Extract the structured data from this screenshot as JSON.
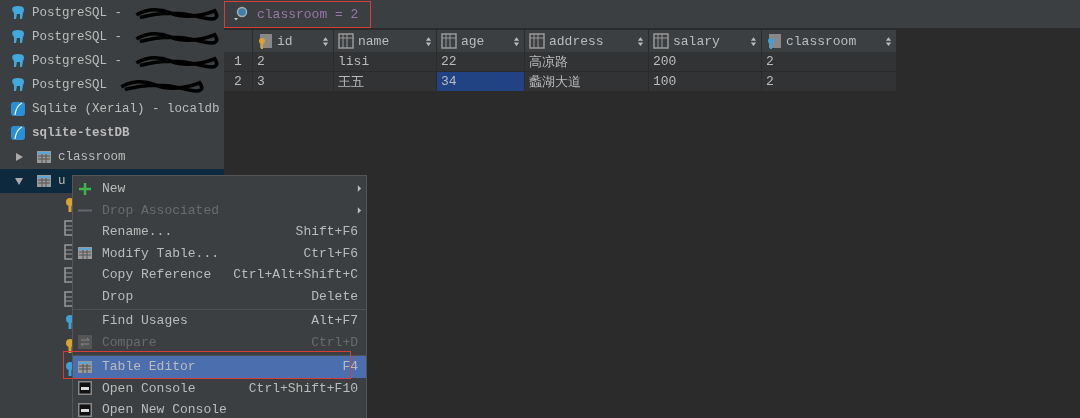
{
  "sidebar": {
    "items": [
      {
        "kind": "postgres",
        "label": "PostgreSQL -"
      },
      {
        "kind": "postgres",
        "label": "PostgreSQL -"
      },
      {
        "kind": "postgres",
        "label": "PostgreSQL -"
      },
      {
        "kind": "postgres",
        "label": "PostgreSQL"
      },
      {
        "kind": "sqlite",
        "label": "Sqlite (Xerial) - localdb"
      },
      {
        "kind": "database",
        "label": "sqlite-testDB",
        "children": [
          {
            "kind": "table",
            "label": "classroom",
            "expanded": false,
            "selected": false
          },
          {
            "kind": "table",
            "label": "u",
            "expanded": true,
            "selected": true,
            "children": [
              {
                "kind": "key-gold"
              },
              {
                "kind": "column"
              },
              {
                "kind": "column"
              },
              {
                "kind": "column"
              },
              {
                "kind": "column"
              },
              {
                "kind": "key-blue"
              },
              {
                "kind": "key-gold"
              },
              {
                "kind": "key-blue"
              }
            ]
          }
        ]
      }
    ]
  },
  "filter": {
    "value": "classroom = 2"
  },
  "table": {
    "columns": [
      {
        "name": "id",
        "kind": "primary-key"
      },
      {
        "name": "name",
        "kind": "column"
      },
      {
        "name": "age",
        "kind": "column"
      },
      {
        "name": "address",
        "kind": "column"
      },
      {
        "name": "salary",
        "kind": "column"
      },
      {
        "name": "classroom",
        "kind": "foreign-key"
      }
    ],
    "rows": [
      {
        "number": "1",
        "cells": [
          {
            "text": "2",
            "selected": false
          },
          {
            "text": "lisi",
            "selected": false
          },
          {
            "text": "22",
            "selected": false
          },
          {
            "text": "高凉路",
            "selected": false
          },
          {
            "text": "200",
            "selected": false
          },
          {
            "text": "2",
            "selected": false
          }
        ]
      },
      {
        "number": "2",
        "cells": [
          {
            "text": "3",
            "selected": false
          },
          {
            "text": "王五",
            "selected": false
          },
          {
            "text": "34",
            "selected": true
          },
          {
            "text": "蠡湖大道",
            "selected": false
          },
          {
            "text": "100",
            "selected": false
          },
          {
            "text": "2",
            "selected": false
          }
        ]
      }
    ]
  },
  "context_menu": {
    "items": [
      {
        "label": "New",
        "kind": "plus",
        "disabled": false,
        "submenu": true,
        "selected": false,
        "separator_before": false
      },
      {
        "label": "Drop Associated",
        "kind": "minus",
        "disabled": true,
        "submenu": true,
        "selected": false,
        "separator_before": false
      },
      {
        "label": "Rename...",
        "shortcut": "Shift+F6",
        "kind": "plain",
        "disabled": false,
        "submenu": false,
        "selected": false,
        "separator_before": false
      },
      {
        "label": "Modify Table...",
        "shortcut": "Ctrl+F6",
        "kind": "table",
        "disabled": false,
        "submenu": false,
        "selected": false,
        "separator_before": false
      },
      {
        "label": "Copy Reference",
        "shortcut": "Ctrl+Alt+Shift+C",
        "kind": "plain",
        "disabled": false,
        "submenu": false,
        "selected": false,
        "separator_before": false
      },
      {
        "label": "Drop",
        "shortcut": "Delete",
        "kind": "plain",
        "disabled": false,
        "submenu": false,
        "selected": false,
        "separator_before": false
      },
      {
        "label": "Find Usages",
        "shortcut": "Alt+F7",
        "kind": "plain",
        "disabled": false,
        "submenu": false,
        "selected": false,
        "separator_before": true
      },
      {
        "label": "Compare",
        "shortcut": "Ctrl+D",
        "kind": "compare",
        "disabled": true,
        "submenu": false,
        "selected": false,
        "separator_before": false
      },
      {
        "label": "Table Editor",
        "shortcut": "F4",
        "kind": "table",
        "disabled": false,
        "submenu": false,
        "selected": true,
        "separator_before": true
      },
      {
        "label": "Open Console",
        "shortcut": "Ctrl+Shift+F10",
        "kind": "console",
        "disabled": false,
        "submenu": false,
        "selected": false,
        "separator_before": false
      },
      {
        "label": "Open New Console",
        "kind": "console",
        "disabled": false,
        "submenu": false,
        "selected": false,
        "separator_before": false
      }
    ]
  }
}
